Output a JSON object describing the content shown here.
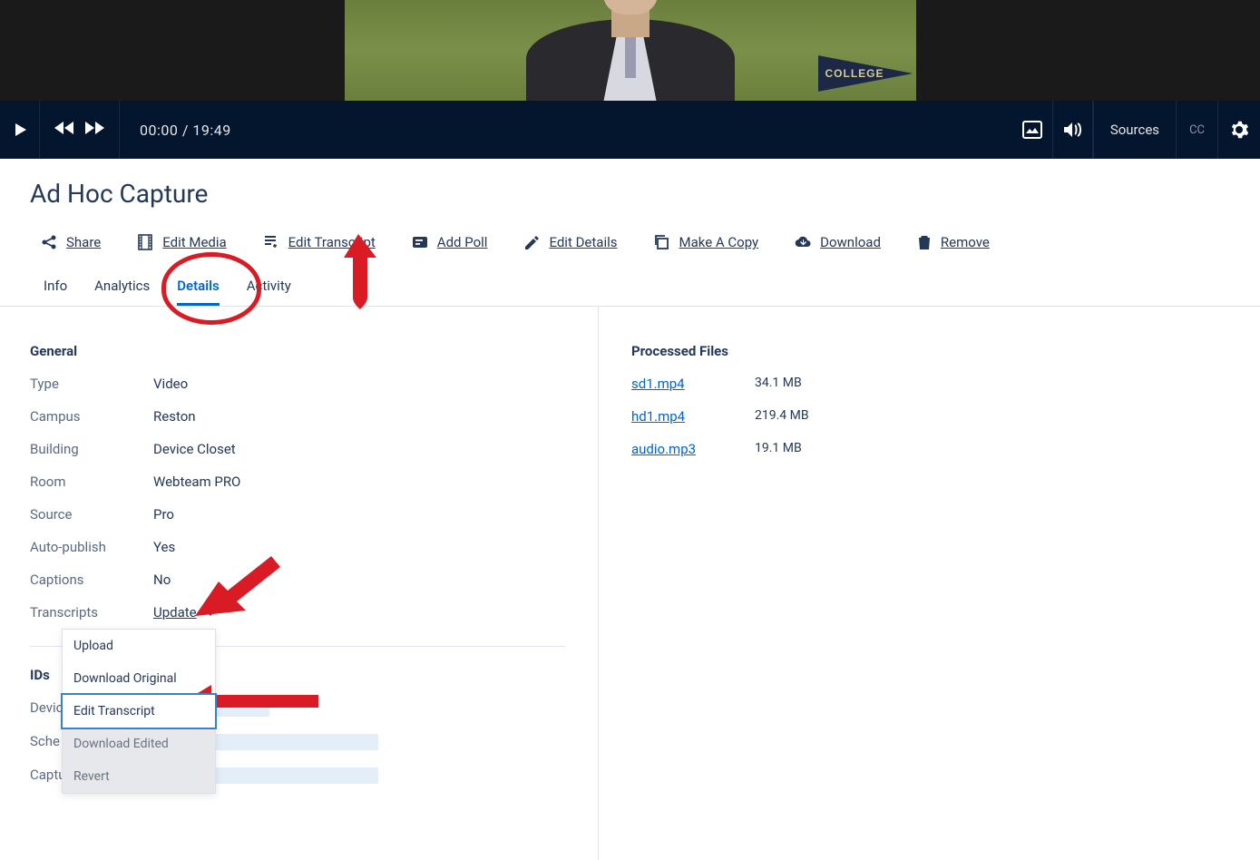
{
  "video": {
    "pennant_text": "COLLEGE",
    "time_current": "00:00",
    "time_total": "19:49",
    "sources_label": "Sources",
    "cc_label": "CC"
  },
  "page_title": "Ad Hoc Capture",
  "actions": {
    "share": "Share",
    "edit_media": "Edit Media",
    "edit_transcript": "Edit Transcript",
    "add_poll": "Add Poll",
    "edit_details": "Edit Details",
    "make_a_copy": "Make A Copy",
    "download": "Download",
    "remove": "Remove"
  },
  "tabs": {
    "info": "Info",
    "analytics": "Analytics",
    "details": "Details",
    "activity": "Activity"
  },
  "details": {
    "general_heading": "General",
    "rows": {
      "type": {
        "label": "Type",
        "value": "Video"
      },
      "campus": {
        "label": "Campus",
        "value": "Reston"
      },
      "building": {
        "label": "Building",
        "value": "Device Closet"
      },
      "room": {
        "label": "Room",
        "value": "Webteam PRO"
      },
      "source": {
        "label": "Source",
        "value": "Pro"
      },
      "auto_publish": {
        "label": "Auto-publish",
        "value": "Yes"
      },
      "captions": {
        "label": "Captions",
        "value": "No"
      },
      "transcripts": {
        "label": "Transcripts",
        "value": "Update"
      }
    },
    "dropdown": {
      "upload": "Upload",
      "download_original": "Download Original",
      "edit_transcript": "Edit Transcript",
      "download_edited": "Download Edited",
      "revert": "Revert"
    },
    "ids_heading": "IDs",
    "id_rows": {
      "device": "Devic",
      "schedule": "Sche",
      "capture_id": "Capture ID"
    }
  },
  "processed_files": {
    "heading": "Processed Files",
    "files": [
      {
        "name": "sd1.mp4",
        "size": "34.1 MB"
      },
      {
        "name": "hd1.mp4",
        "size": "219.4 MB"
      },
      {
        "name": "audio.mp3",
        "size": "19.1 MB"
      }
    ]
  }
}
